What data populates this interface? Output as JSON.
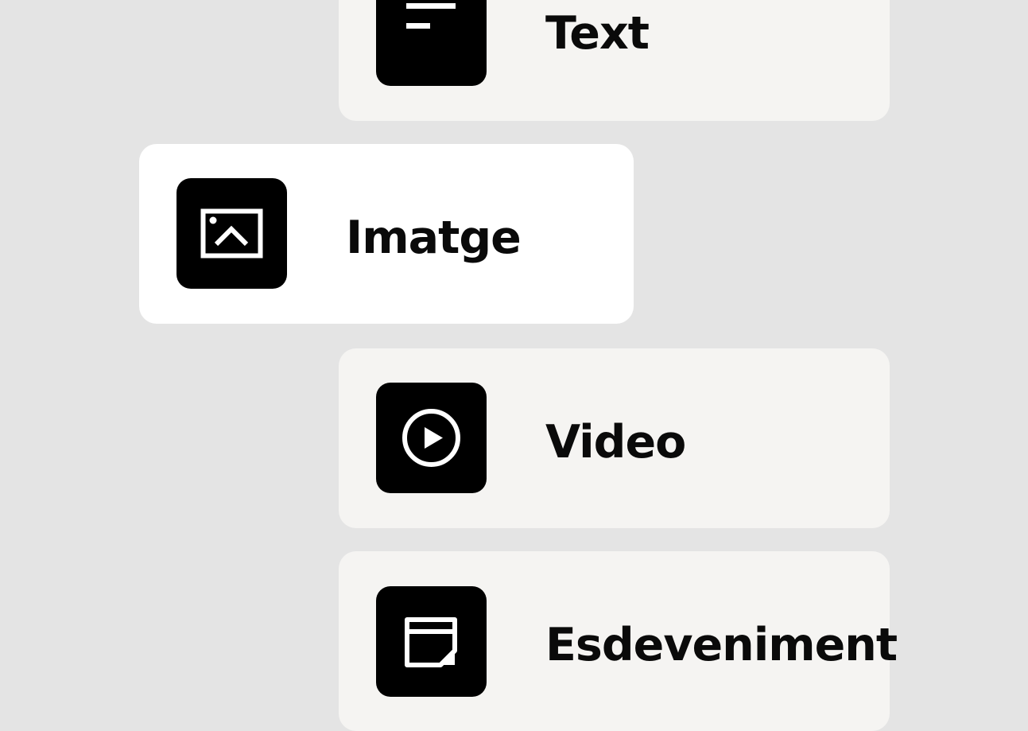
{
  "items": [
    {
      "label": "Text",
      "icon": "text-lines-icon",
      "selected": false
    },
    {
      "label": "Imatge",
      "icon": "image-icon",
      "selected": true
    },
    {
      "label": "Video",
      "icon": "play-circle-icon",
      "selected": false
    },
    {
      "label": "Esdeveniment",
      "icon": "event-edit-icon",
      "selected": false
    }
  ],
  "colors": {
    "background": "#e4e4e4",
    "card": "#f5f4f2",
    "card_selected": "#ffffff",
    "icon_tile": "#000000",
    "text": "#0a0a0a"
  }
}
